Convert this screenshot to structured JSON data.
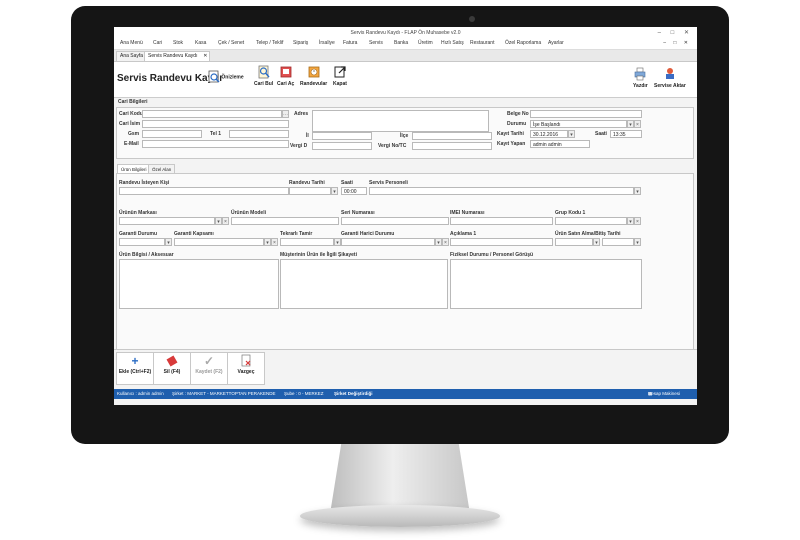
{
  "window": {
    "title": "Servis Randevu Kaydı - FLAP Ön Muhasebe v2.0",
    "controls": "–  □  ✕",
    "menu_controls": "–  □  ✕"
  },
  "menu": [
    "Ana Menü",
    "Cari",
    "Stok",
    "Kasa",
    "Çek / Senet",
    "Telep / Teklif",
    "Sipariş",
    "İrsaliye",
    "Fatura",
    "Servis",
    "Banka",
    "Üretim",
    "Hızlı Satış",
    "Restaurant",
    "Özel Raporlama",
    "Ayarlar"
  ],
  "tabs": {
    "home": "Ana Sayfa",
    "active": "Servis Randevu Kaydı",
    "close": "✕"
  },
  "toolbar": {
    "form_title": "Servis Randevu Kaydı",
    "preview": "Önizleme",
    "find_account": "Cari Bul",
    "open_account": "Cari Aç",
    "appointments": "Randevular",
    "close": "Kapat",
    "print": "Yazdır",
    "transfer": "Servise Aktar"
  },
  "cari": {
    "section": "Cari Bilgileri",
    "labels": {
      "code": "Cari Kodu",
      "name": "Cari İsim",
      "gsm": "Gsm",
      "tel1": "Tel 1",
      "email": "E-Mail",
      "address": "Adres",
      "city": "İl",
      "district": "İlçe",
      "tax_office": "Vergi D",
      "tax_no": "Vergi No/TC",
      "doc_no": "Belge No",
      "status": "Durumu",
      "record_date": "Kayıt Tarihi",
      "time": "Saati",
      "recorder": "Kayıt Yapan"
    },
    "values": {
      "status": "İşe Başlandı",
      "record_date": "30.12.2016",
      "time": "13:35",
      "recorder": "admin admin"
    },
    "code_btn": "⋯"
  },
  "subtabs": {
    "product": "Ürün Bilgileri",
    "custom": "Özel Alan"
  },
  "product": {
    "labels": {
      "requester": "Randevu İsteyen Kişi",
      "appointment_date": "Randevu Tarihi",
      "hour": "Saati",
      "staff": "Servis Personeli",
      "brand": "Ürünün Markası",
      "model": "Ürünün Modeli",
      "serial": "Seri Numarası",
      "imei": "IMEI Numarası",
      "group_code": "Grup Kodu 1",
      "warranty_status": "Garanti Durumu",
      "warranty_scope": "Garanti Kapsamı",
      "repeat_repair": "Tekrarlı Tamir",
      "out_of_warranty": "Garanti Harici Durumu",
      "description": "Açıklama 1",
      "purchase_date": "Ürün Satın Alma/Bitiş Tarihi",
      "accessory": "Ürün Bilgisi / Aksesuar",
      "complaint": "Müşterinin Ürün ile İlgili Şikayeti",
      "physical": "Fiziksel Durumu / Personel Görüşü"
    },
    "values": {
      "hour": "00:00"
    }
  },
  "actions": {
    "add": "Ekle (Ctrl+F2)",
    "delete": "Sil (F4)",
    "save": "Kaydet (F2)",
    "cancel": "Vazgeç"
  },
  "status": {
    "user": "Kullanıcı : admin admin",
    "company": "Şirket : MARKET - MARKETTOPTAN PERAKENDE",
    "branch": "Şube : 0 - MERKEZ",
    "change_company": "Şirket Değiştirdiği",
    "calculator": "Hesap Makinesi"
  },
  "colors": {
    "accent": "#1f5fae",
    "status_bar": "#1f5fae",
    "add_icon": "#2a6cc4",
    "delete_icon": "#d83a3a"
  },
  "icons": {
    "preview": "magnifier-icon",
    "find": "search-icon",
    "open": "folder-icon",
    "appointments": "calendar-icon",
    "close": "exit-icon",
    "print": "printer-icon",
    "transfer": "transfer-icon",
    "add": "plus-icon",
    "delete": "eraser-icon",
    "save": "check-icon",
    "cancel": "cancel-doc-icon",
    "calculator": "calculator-icon"
  }
}
